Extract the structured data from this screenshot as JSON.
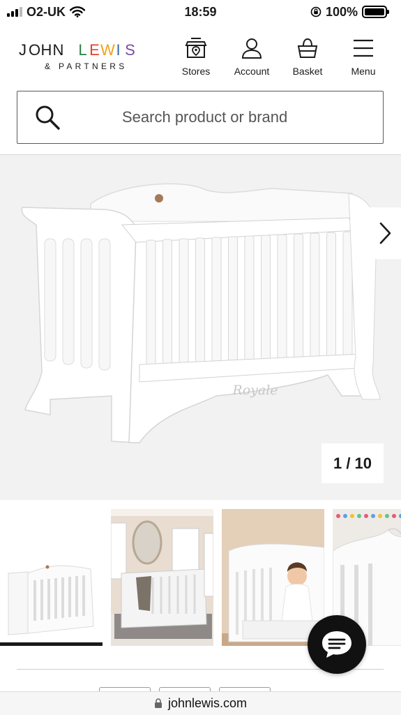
{
  "status_bar": {
    "carrier": "O2-UK",
    "time": "18:59",
    "battery": "100%"
  },
  "header": {
    "logo": {
      "letters": [
        "J",
        "O",
        "H",
        "N",
        "",
        "L",
        "E",
        "W",
        "I",
        "S"
      ],
      "letter_colors": [
        "#1a1a1a",
        "#1a1a1a",
        "#1a1a1a",
        "#1a1a1a",
        "",
        "#2d7d46",
        "#e2432b",
        "#f2a21a",
        "#3a68b5",
        "#7b4aa6"
      ],
      "sub": "& PARTNERS"
    },
    "nav": [
      {
        "label": "Stores",
        "icon": "stores-icon"
      },
      {
        "label": "Account",
        "icon": "account-icon"
      },
      {
        "label": "Basket",
        "icon": "basket-icon"
      },
      {
        "label": "Menu",
        "icon": "menu-icon"
      }
    ]
  },
  "search": {
    "placeholder": "Search product or brand"
  },
  "gallery": {
    "counter": "1 / 10",
    "crib_script": "Royale",
    "current_index": 1,
    "total": 10
  },
  "url": "johnlewis.com",
  "colors": {
    "accent": "#1a1a1a",
    "gallery_bg": "#f2f2f2"
  }
}
